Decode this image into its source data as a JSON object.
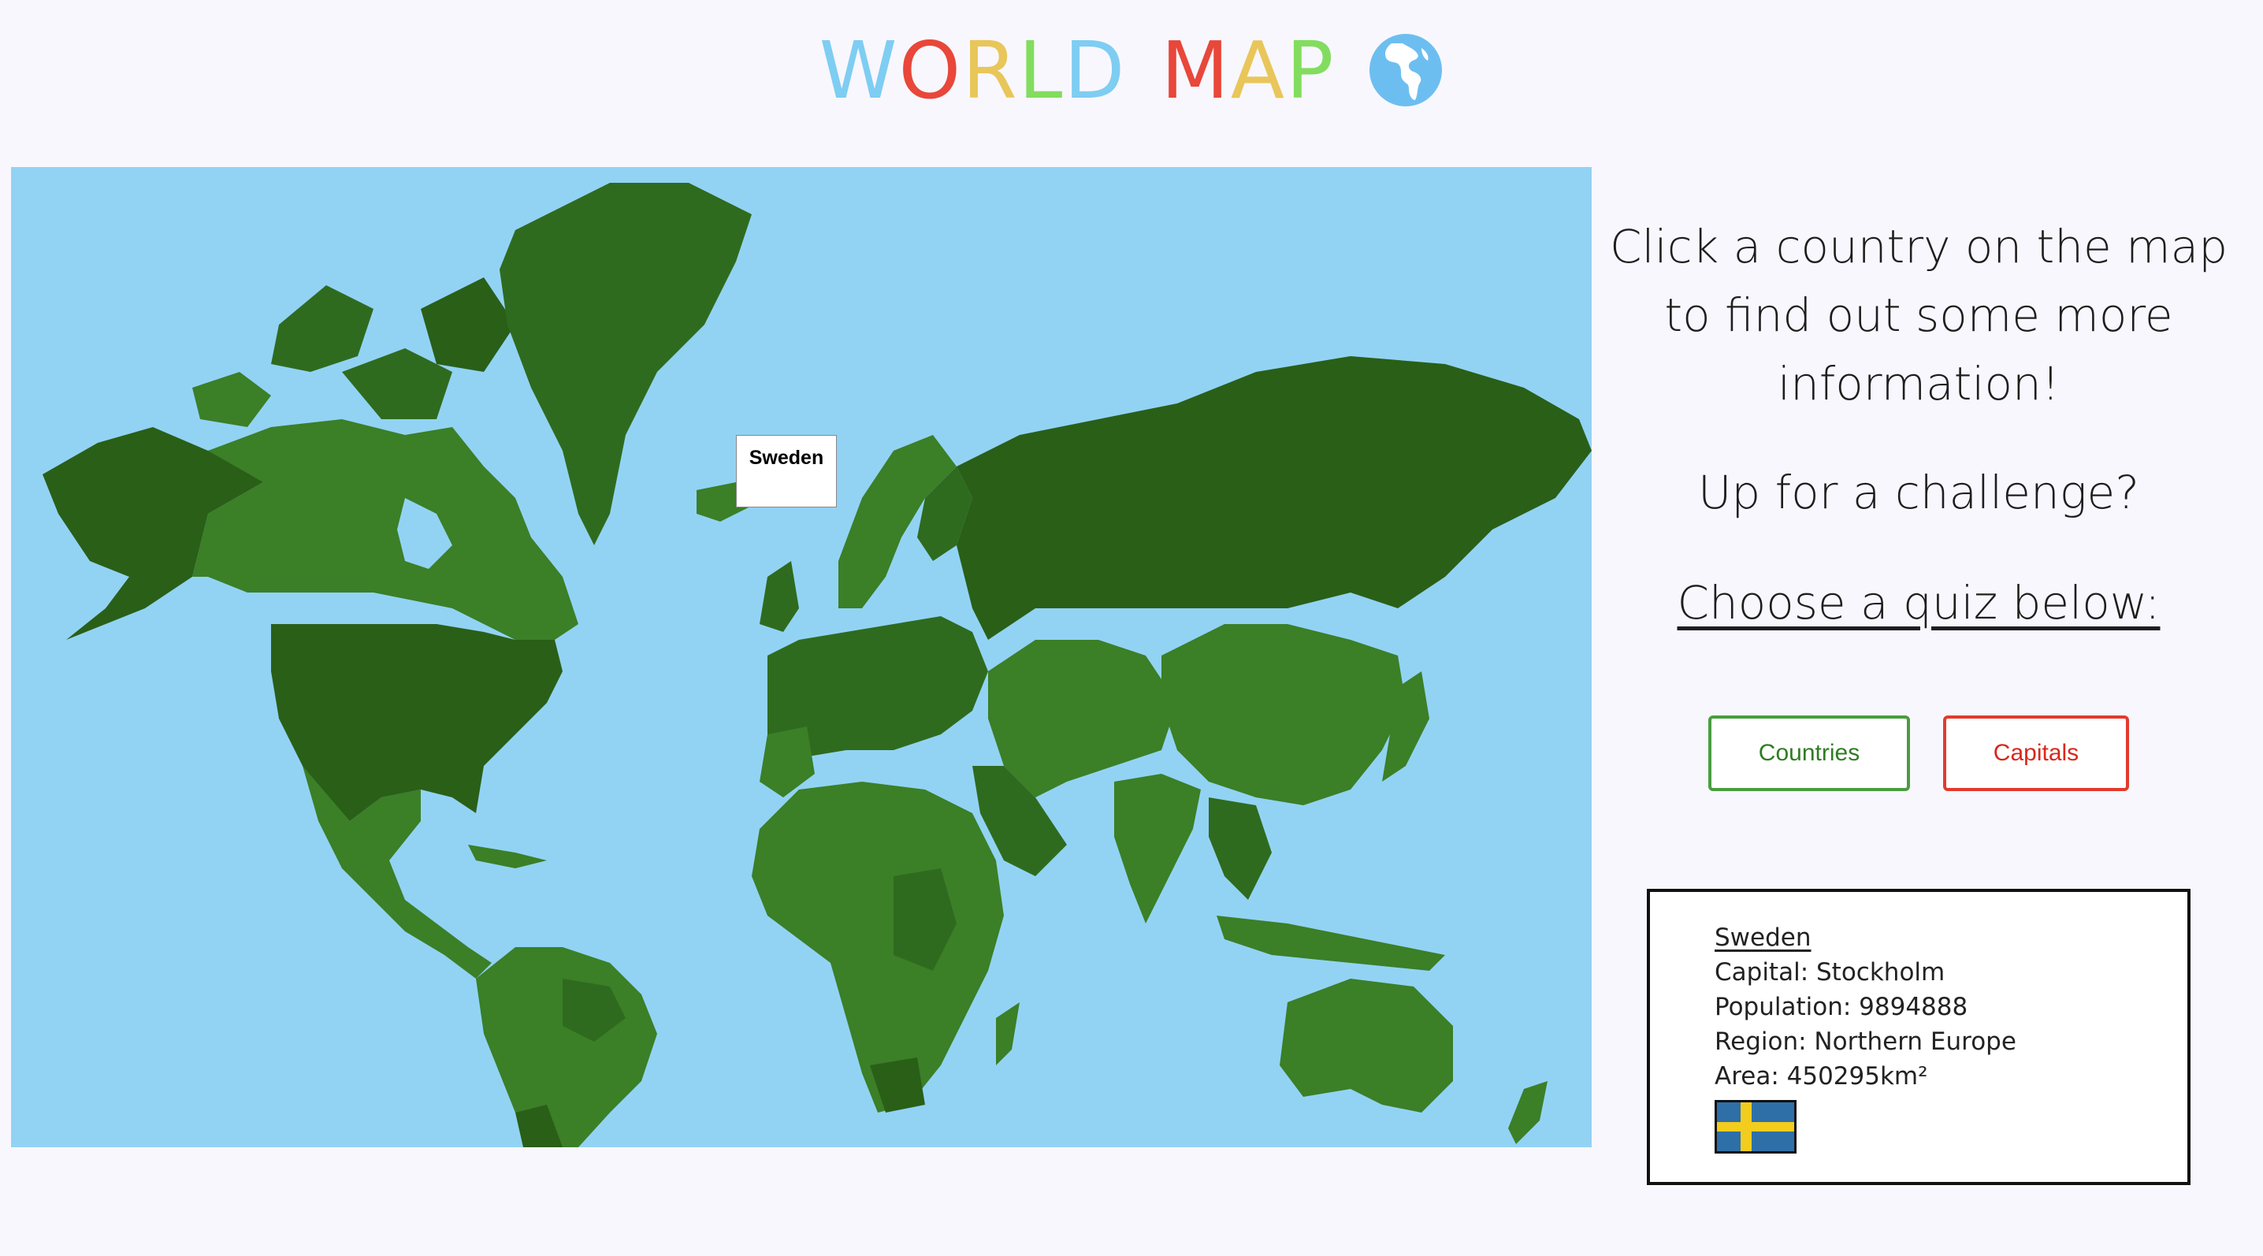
{
  "header": {
    "title_letters": [
      {
        "char": "W",
        "color": "#7ecdf2"
      },
      {
        "char": "O",
        "color": "#e8473a"
      },
      {
        "char": "R",
        "color": "#e8c65a"
      },
      {
        "char": "L",
        "color": "#82dd5e"
      },
      {
        "char": "D",
        "color": "#7ecdf2"
      },
      {
        "char": "M",
        "color": "#e8473a"
      },
      {
        "char": "A",
        "color": "#e8c65a"
      },
      {
        "char": "P",
        "color": "#82dd5e"
      }
    ],
    "icon": "globe-americas-icon"
  },
  "map": {
    "ocean_color": "#92d3f4",
    "land_colors": [
      "#2f6b1e",
      "#3b7f27",
      "#2a5f18"
    ],
    "tooltip": "Sweden"
  },
  "sidebar": {
    "prompt": "Click a country on the map to find out some more information!",
    "challenge": "Up for a challenge?",
    "choose": "Choose a quiz below:",
    "buttons": {
      "countries": "Countries",
      "capitals": "Capitals"
    }
  },
  "country_info": {
    "name": "Sweden",
    "capital": "Capital: Stockholm",
    "population": "Population: 9894888",
    "region": "Region: Northern Europe",
    "area": "Area: 450295km²",
    "flag_colors": {
      "field": "#2f6fa8",
      "cross": "#f3cd1d"
    }
  }
}
